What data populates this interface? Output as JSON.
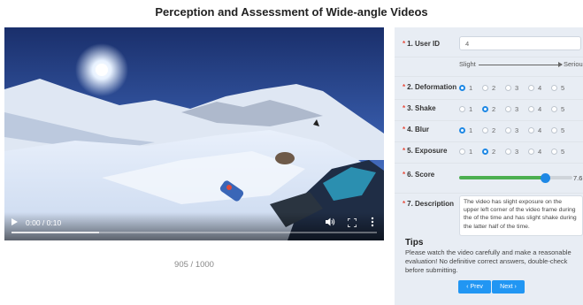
{
  "page": {
    "title": "Perception and Assessment of Wide-angle Videos"
  },
  "video": {
    "time": "0:00 / 0:10",
    "progress": 0.0,
    "buffered": 0.24
  },
  "counter": "905 / 1000",
  "form": {
    "user_id": {
      "label": "1. User ID",
      "value": "4"
    },
    "scale": {
      "left": "Slight",
      "right": "Serious"
    },
    "dimensions": [
      {
        "label": "2. Deformation",
        "options": [
          "1",
          "2",
          "3",
          "4",
          "5"
        ],
        "selected": 1
      },
      {
        "label": "3. Shake",
        "options": [
          "1",
          "2",
          "3",
          "4",
          "5"
        ],
        "selected": 2
      },
      {
        "label": "4. Blur",
        "options": [
          "1",
          "2",
          "3",
          "4",
          "5"
        ],
        "selected": 1
      },
      {
        "label": "5. Exposure",
        "options": [
          "1",
          "2",
          "3",
          "4",
          "5"
        ],
        "selected": 2
      }
    ],
    "score": {
      "label": "6. Score",
      "value": "7.6",
      "fraction": 0.76
    },
    "description": {
      "label": "7. Description",
      "text": "The video has slight exposure on the upper left corner of the video frame during the of the time and has slight shake during the latter half of the time."
    },
    "required_mark": "*"
  },
  "tips": {
    "title": "Tips",
    "text": "Please watch the video carefully and make a reasonable evaluation! No definitive correct answers, double-check before submitting."
  },
  "nav": {
    "prev": "Prev",
    "next": "Next"
  },
  "colors": {
    "accent": "#1e88e5",
    "slider_fill": "#4caf50",
    "required": "#e74c3c",
    "panel_bg": "#e8edf4"
  }
}
